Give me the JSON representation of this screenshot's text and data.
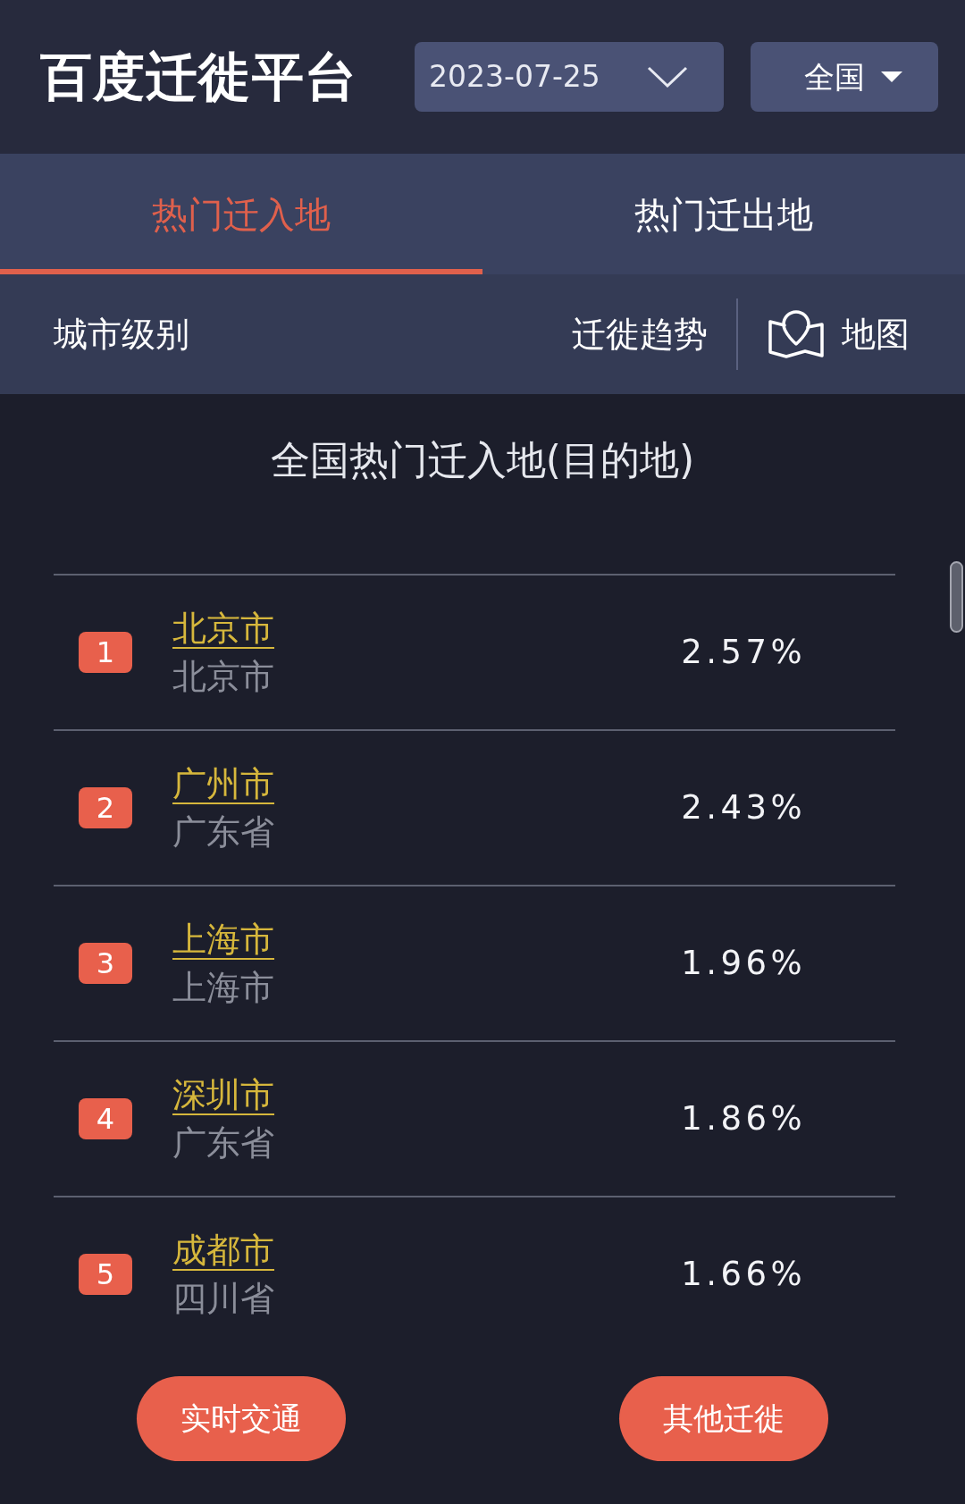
{
  "header": {
    "title": "百度迁徙平台",
    "date_select": {
      "value": "2023-07-25"
    },
    "region_select": {
      "value": "全国"
    }
  },
  "tabs": [
    {
      "label": "热门迁入地",
      "selected": true
    },
    {
      "label": "热门迁出地",
      "selected": false
    }
  ],
  "toolbar": {
    "city_level": "城市级别",
    "trend": "迁徙趋势",
    "map": "地图"
  },
  "list": {
    "title": "全国热门迁入地(目的地)",
    "rows": [
      {
        "rank": "1",
        "city": "北京市",
        "province": "北京市",
        "share": "2.57%"
      },
      {
        "rank": "2",
        "city": "广州市",
        "province": "广东省",
        "share": "2.43%"
      },
      {
        "rank": "3",
        "city": "上海市",
        "province": "上海市",
        "share": "1.96%"
      },
      {
        "rank": "4",
        "city": "深圳市",
        "province": "广东省",
        "share": "1.86%"
      },
      {
        "rank": "5",
        "city": "成都市",
        "province": "四川省",
        "share": "1.66%"
      }
    ]
  },
  "buttons": [
    {
      "label": "实时交通"
    },
    {
      "label": "其他迁徙"
    }
  ]
}
